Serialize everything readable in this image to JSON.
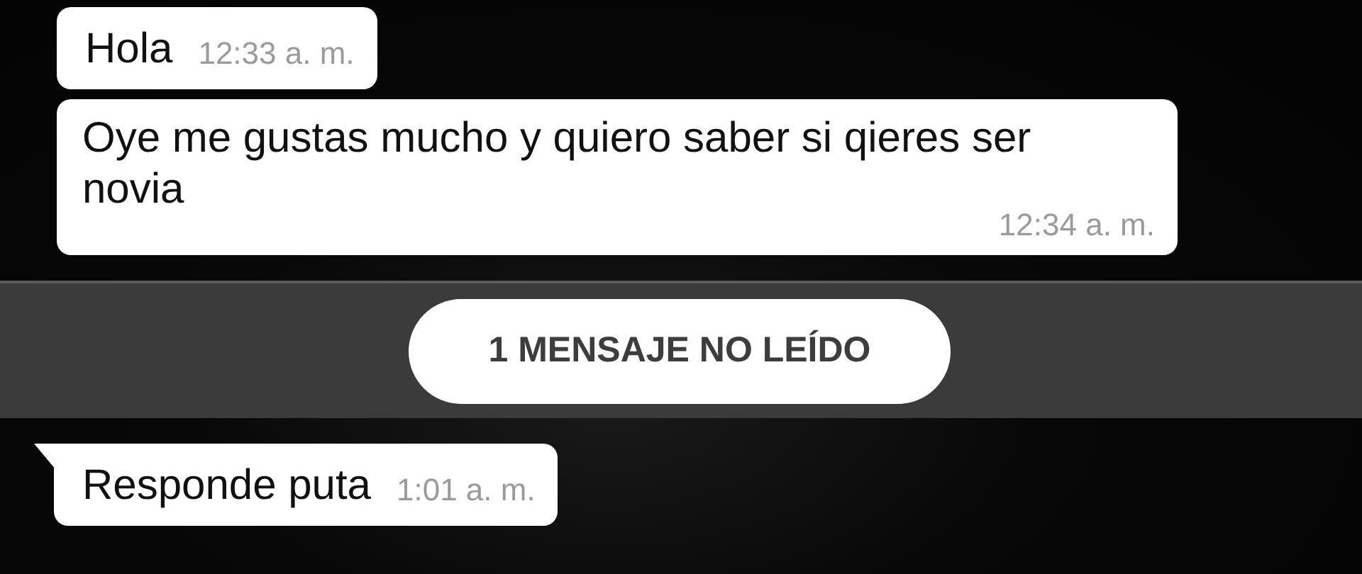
{
  "messages_before": [
    {
      "text": "Hola",
      "time": "12:33 a. m.",
      "tail": false,
      "kind": "inline"
    },
    {
      "text": "Oye me gustas mucho y quiero saber si qieres ser novia",
      "time": "12:34 a. m.",
      "tail": false,
      "kind": "stacked"
    }
  ],
  "unread_divider": {
    "label": "1 MENSAJE NO LEÍDO"
  },
  "messages_after": [
    {
      "text": "Responde puta",
      "time": "1:01 a. m.",
      "tail": true,
      "kind": "inline"
    }
  ]
}
